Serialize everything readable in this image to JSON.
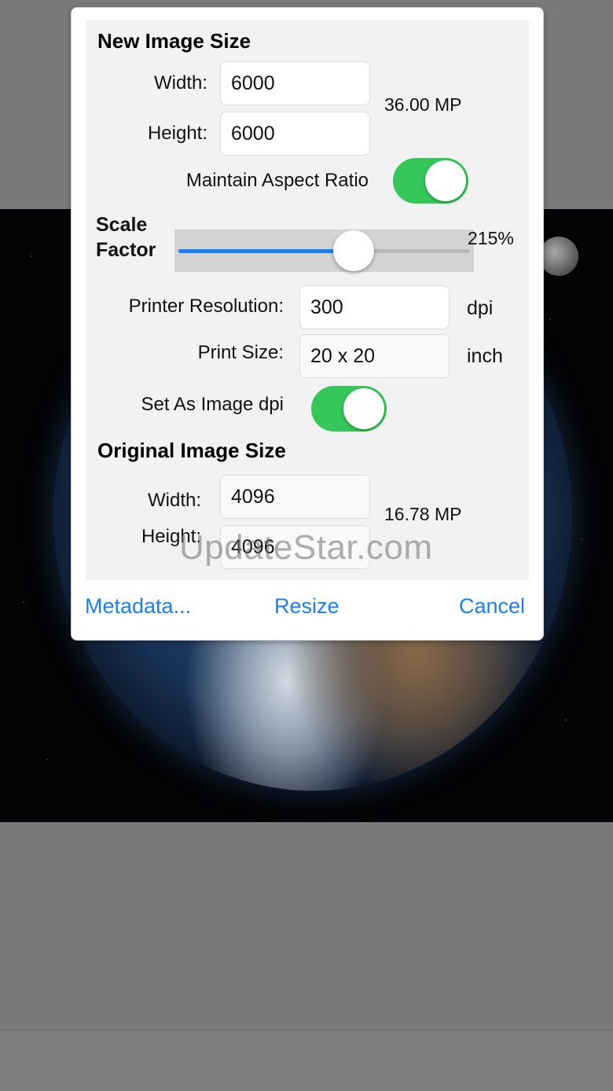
{
  "dialog": {
    "new_size": {
      "title": "New Image Size",
      "width_label": "Width:",
      "width_value": "6000",
      "height_label": "Height:",
      "height_value": "6000",
      "megapixels": "36.00 MP",
      "aspect_label": "Maintain Aspect Ratio",
      "aspect_on": true,
      "scale_label": "Scale Factor",
      "scale_value": "215%",
      "scale_fraction": 0.6
    },
    "print": {
      "resolution_label": "Printer Resolution:",
      "resolution_value": "300",
      "resolution_unit": "dpi",
      "size_label": "Print Size:",
      "size_value": "20 x 20",
      "size_unit": "inch",
      "set_dpi_label": "Set As Image dpi",
      "set_dpi_on": true
    },
    "original": {
      "title": "Original Image Size",
      "width_label": "Width:",
      "width_value": "4096",
      "height_label": "Height:",
      "height_value": "4096",
      "megapixels": "16.78 MP"
    },
    "actions": {
      "metadata": "Metadata...",
      "resize": "Resize",
      "cancel": "Cancel"
    }
  },
  "watermark": "UpdateStar.com",
  "colors": {
    "accent": "#1a7ef5",
    "toggle_on": "#35c759"
  }
}
